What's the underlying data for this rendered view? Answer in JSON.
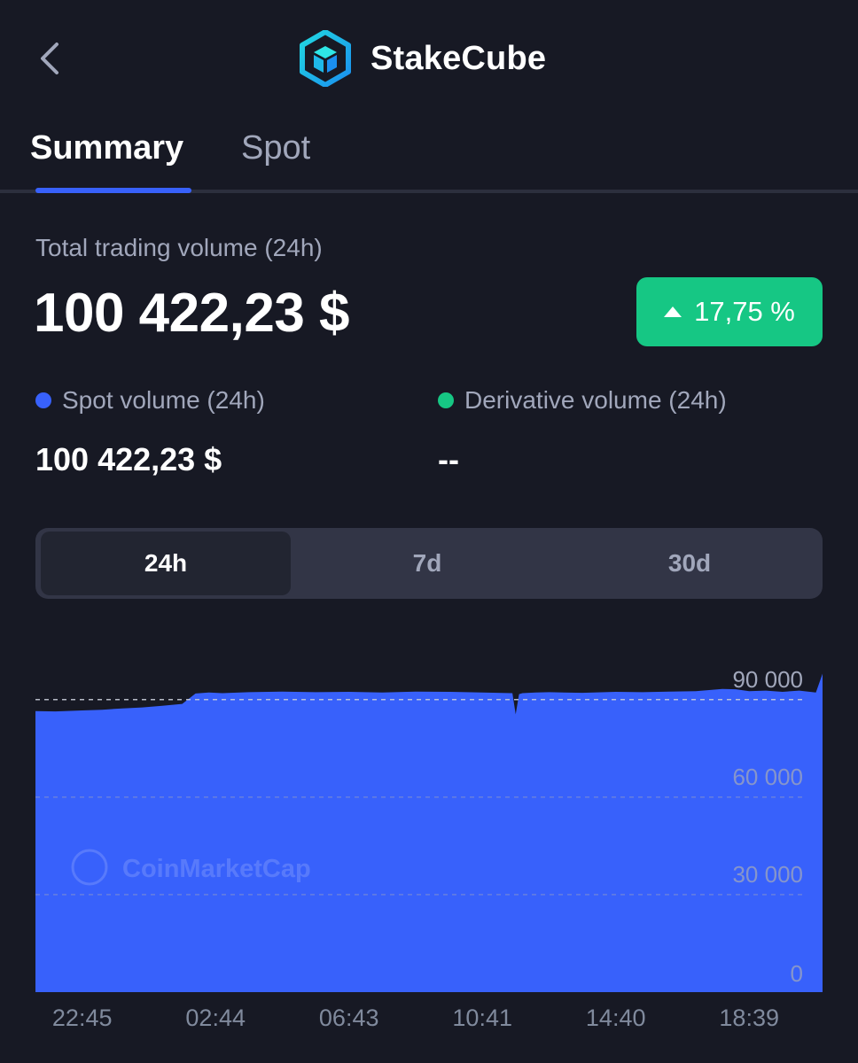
{
  "header": {
    "back_icon": "chevron-left-icon",
    "brand_name": "StakeCube",
    "logo_icon": "stakecube-cube-icon",
    "logo_colors": [
      "#1fd3e0",
      "#1a9cf0"
    ]
  },
  "tabs": [
    {
      "label": "Summary",
      "active": true
    },
    {
      "label": "Spot",
      "active": false
    }
  ],
  "summary": {
    "total_label": "Total trading volume (24h)",
    "total_value": "100 422,23 $",
    "change": {
      "value": "17,75 %",
      "direction": "up",
      "color": "#16c784"
    },
    "spot": {
      "label": "Spot volume (24h)",
      "value": "100 422,23 $",
      "color": "#3861fb"
    },
    "derivative": {
      "label": "Derivative volume (24h)",
      "value": "--",
      "color": "#16c784"
    }
  },
  "range_selector": {
    "options": [
      "24h",
      "7d",
      "30d"
    ],
    "selected": "24h"
  },
  "colors": {
    "background": "#171924",
    "accent": "#3861fb",
    "positive": "#16c784",
    "muted_text": "#a1a7bb"
  },
  "chart_data": {
    "type": "area",
    "x_tick_labels": [
      "22:45",
      "02:44",
      "06:43",
      "10:41",
      "14:40",
      "18:39"
    ],
    "y_tick_labels": [
      "90 000",
      "60 000",
      "30 000",
      "0"
    ],
    "y_ticks": [
      90000,
      60000,
      30000,
      0
    ],
    "ylim": [
      0,
      100000
    ],
    "x_range_hours": [
      0,
      24
    ],
    "x_tick_hours": [
      0,
      4,
      8,
      12,
      16,
      20
    ],
    "reference_value": 90000,
    "grid": "horizontal-dashed",
    "color": "#3861fb",
    "watermark": "CoinMarketCap",
    "series": [
      {
        "x_hours": [
          -1.4,
          -0.8,
          0,
          0.6,
          1.2,
          1.8,
          2.4,
          3.0,
          3.4,
          3.8,
          4.2,
          5,
          6,
          7,
          8,
          9,
          10,
          11,
          12,
          12.9,
          13.0,
          13.1,
          13.2,
          13.6,
          14,
          15,
          16,
          16.8,
          17.6,
          18.4,
          19.2,
          19.6,
          20,
          20.5,
          21,
          21.5,
          22,
          22.2
        ],
        "values": [
          86500,
          86400,
          86700,
          86900,
          87300,
          87600,
          88100,
          88700,
          91900,
          92200,
          92000,
          92300,
          92500,
          92300,
          92400,
          92200,
          92500,
          92400,
          92200,
          92000,
          85500,
          91700,
          92000,
          92200,
          92300,
          92100,
          92400,
          92300,
          92500,
          92600,
          93300,
          93200,
          92600,
          92800,
          92400,
          92800,
          92200,
          98000
        ]
      }
    ]
  }
}
